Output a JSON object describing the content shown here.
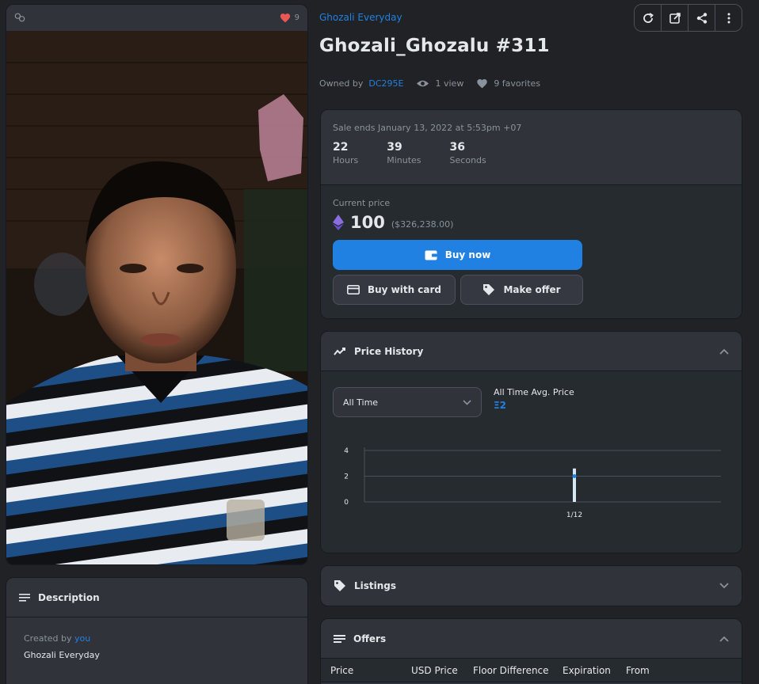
{
  "image_card": {
    "favorite_count": "9"
  },
  "description": {
    "header": "Description",
    "created_by_prefix": "Created by",
    "created_by_link": "you",
    "collection_name": "Ghozali Everyday"
  },
  "collection_link": "Ghozali Everyday",
  "item_title": "Ghozali_Ghozalu #311",
  "meta": {
    "owned_by_prefix": "Owned by",
    "owner": "DC295E",
    "views": "1 view",
    "favorites": "9 favorites"
  },
  "sale": {
    "ends_text": "Sale ends January 13, 2022 at 5:53pm +07",
    "countdown": [
      {
        "value": "22",
        "label": "Hours"
      },
      {
        "value": "39",
        "label": "Minutes"
      },
      {
        "value": "36",
        "label": "Seconds"
      }
    ],
    "current_price_label": "Current price",
    "price": "100",
    "price_usd": "($326,238.00)",
    "buy_now": "Buy now",
    "buy_with_card": "Buy with card",
    "make_offer": "Make offer"
  },
  "price_history": {
    "header": "Price History",
    "range_selected": "All Time",
    "avg_label": "All Time Avg. Price",
    "avg_value": "Ξ2"
  },
  "chart_data": {
    "type": "line",
    "x": [
      "1/12"
    ],
    "series": [
      {
        "values": [
          2
        ]
      }
    ],
    "ylim": [
      0,
      4
    ],
    "yticks": [
      "0",
      "2",
      "4"
    ],
    "grid": true
  },
  "listings": {
    "header": "Listings"
  },
  "offers": {
    "header": "Offers",
    "columns": [
      "Price",
      "USD Price",
      "Floor Difference",
      "Expiration",
      "From"
    ]
  },
  "colors": {
    "accent": "#2081e2",
    "background": "#202225",
    "panel": "#303339",
    "heart": "#eb5757"
  }
}
